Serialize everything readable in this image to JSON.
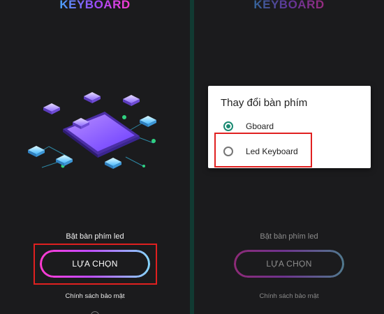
{
  "left": {
    "logo": "KEYBOARD",
    "subtitle": "Bật bàn phím led",
    "select_button": "LỰA CHỌN",
    "privacy_link": "Chính sách bảo mật"
  },
  "right": {
    "logo": "KEYBOARD",
    "subtitle": "Bật bàn phím led",
    "select_button": "LỰA CHỌN",
    "privacy_link": "Chính sách bảo mật",
    "dialog": {
      "title": "Thay đổi bàn phím",
      "options": [
        {
          "label": "Gboard",
          "selected": true
        },
        {
          "label": "Led Keyboard",
          "selected": false
        }
      ]
    }
  },
  "colors": {
    "accent": "#1a8a72",
    "highlight_box": "#e02020",
    "gradient": [
      "#ff3ad0",
      "#c04cff",
      "#86d7ff"
    ]
  }
}
